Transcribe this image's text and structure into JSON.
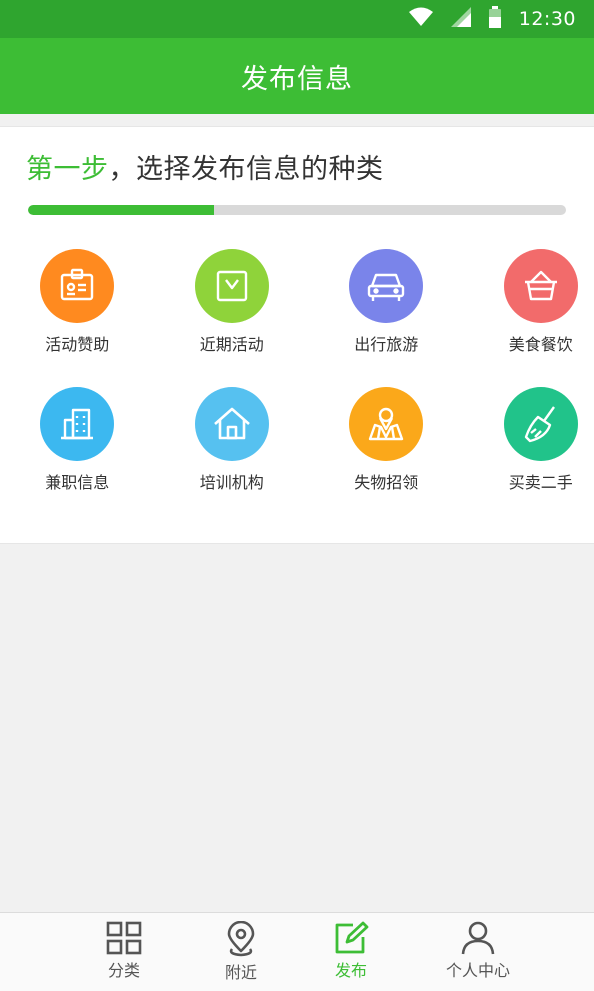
{
  "status_bar": {
    "time": "12:30",
    "icons": [
      "wifi-icon",
      "signal-icon",
      "battery-icon"
    ]
  },
  "app_bar": {
    "title": "发布信息"
  },
  "step": {
    "title_highlight": "第一步",
    "title_rest": "，选择发布信息的种类",
    "progress_percent": 34.5
  },
  "categories": [
    {
      "label": "活动赞助",
      "icon": "badge-icon",
      "color": "#ff8a1f"
    },
    {
      "label": "近期活动",
      "icon": "calendar-icon",
      "color": "#8fd33a"
    },
    {
      "label": "出行旅游",
      "icon": "car-icon",
      "color": "#7a84ea"
    },
    {
      "label": "美食餐饮",
      "icon": "basket-icon",
      "color": "#f26b6b"
    },
    {
      "label": "兼职信息",
      "icon": "building-icon",
      "color": "#3cb8f0"
    },
    {
      "label": "培训机构",
      "icon": "house-icon",
      "color": "#56c1f0"
    },
    {
      "label": "失物招领",
      "icon": "map-pin-icon",
      "color": "#fba81a"
    },
    {
      "label": "买卖二手",
      "icon": "broom-icon",
      "color": "#21c38a"
    }
  ],
  "tabs": [
    {
      "label": "分类",
      "icon": "grid-icon",
      "active": false
    },
    {
      "label": "附近",
      "icon": "location-icon",
      "active": false
    },
    {
      "label": "发布",
      "icon": "edit-icon",
      "active": true
    },
    {
      "label": "个人中心",
      "icon": "person-icon",
      "active": false
    }
  ],
  "colors": {
    "brand": "#3dbd35",
    "status_bar": "#2fa52f"
  }
}
